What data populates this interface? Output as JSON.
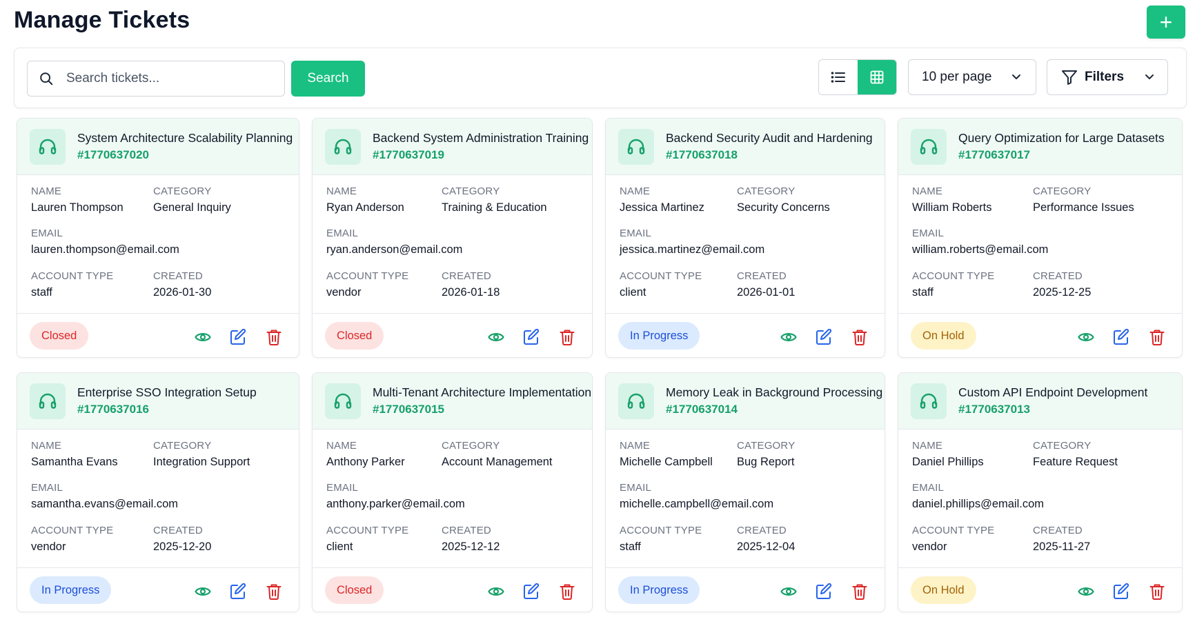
{
  "page": {
    "title": "Manage Tickets",
    "add_label": "+"
  },
  "toolbar": {
    "search_placeholder": "Search tickets...",
    "search_label": "Search",
    "per_page": "10 per page",
    "filters_label": "Filters"
  },
  "labels": {
    "name": "NAME",
    "category": "CATEGORY",
    "email": "EMAIL",
    "account_type": "ACCOUNT TYPE",
    "created": "CREATED"
  },
  "colors": {
    "accent": "#19c081",
    "closed": "#dc2626",
    "in_progress": "#1d4ed8",
    "on_hold": "#a16207"
  },
  "tickets": [
    {
      "title": "System Architecture Scalability Planning",
      "id": "#1770637020",
      "name": "Lauren Thompson",
      "category": "General Inquiry",
      "email": "lauren.thompson@email.com",
      "account_type": "staff",
      "created": "2026-01-30",
      "status": "Closed"
    },
    {
      "title": "Backend System Administration Training",
      "id": "#1770637019",
      "name": "Ryan Anderson",
      "category": "Training & Education",
      "email": "ryan.anderson@email.com",
      "account_type": "vendor",
      "created": "2026-01-18",
      "status": "Closed"
    },
    {
      "title": "Backend Security Audit and Hardening",
      "id": "#1770637018",
      "name": "Jessica Martinez",
      "category": "Security Concerns",
      "email": "jessica.martinez@email.com",
      "account_type": "client",
      "created": "2026-01-01",
      "status": "In Progress"
    },
    {
      "title": "Query Optimization for Large Datasets",
      "id": "#1770637017",
      "name": "William Roberts",
      "category": "Performance Issues",
      "email": "william.roberts@email.com",
      "account_type": "staff",
      "created": "2025-12-25",
      "status": "On Hold"
    },
    {
      "title": "Enterprise SSO Integration Setup",
      "id": "#1770637016",
      "name": "Samantha Evans",
      "category": "Integration Support",
      "email": "samantha.evans@email.com",
      "account_type": "vendor",
      "created": "2025-12-20",
      "status": "In Progress"
    },
    {
      "title": "Multi-Tenant Architecture Implementation",
      "id": "#1770637015",
      "name": "Anthony Parker",
      "category": "Account Management",
      "email": "anthony.parker@email.com",
      "account_type": "client",
      "created": "2025-12-12",
      "status": "Closed"
    },
    {
      "title": "Memory Leak in Background Processing",
      "id": "#1770637014",
      "name": "Michelle Campbell",
      "category": "Bug Report",
      "email": "michelle.campbell@email.com",
      "account_type": "staff",
      "created": "2025-12-04",
      "status": "In Progress"
    },
    {
      "title": "Custom API Endpoint Development",
      "id": "#1770637013",
      "name": "Daniel Phillips",
      "category": "Feature Request",
      "email": "daniel.phillips@email.com",
      "account_type": "vendor",
      "created": "2025-11-27",
      "status": "On Hold"
    }
  ]
}
